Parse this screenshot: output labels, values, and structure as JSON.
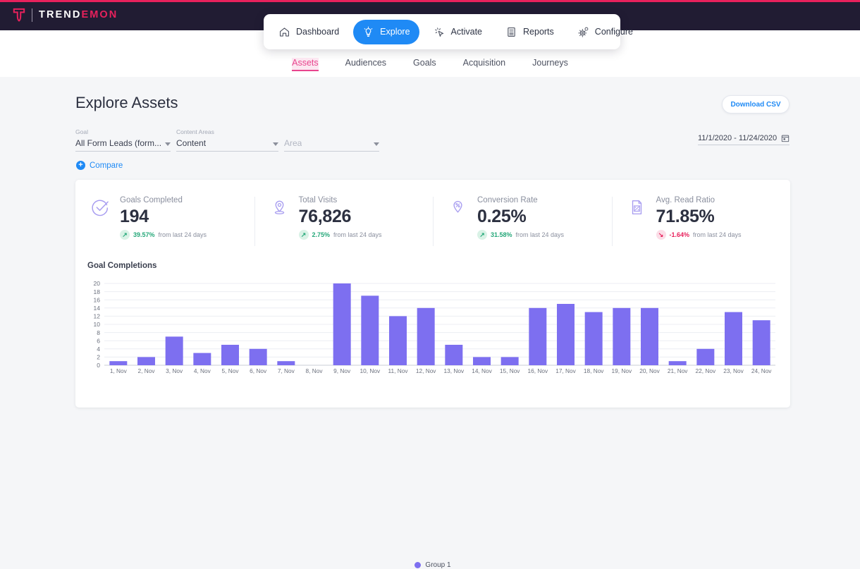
{
  "brand": {
    "name_part1": "TREND",
    "name_part2": "EMON"
  },
  "nav": {
    "items": [
      {
        "label": "Dashboard",
        "icon": "home-icon",
        "active": false
      },
      {
        "label": "Explore",
        "icon": "lightbulb-icon",
        "active": true
      },
      {
        "label": "Activate",
        "icon": "cursor-click-icon",
        "active": false
      },
      {
        "label": "Reports",
        "icon": "report-document-icon",
        "active": false
      },
      {
        "label": "Configure",
        "icon": "gear-icon",
        "active": false
      }
    ],
    "active_color": "#1f8af5"
  },
  "subtabs": {
    "items": [
      {
        "label": "Assets",
        "active": true
      },
      {
        "label": "Audiences",
        "active": false
      },
      {
        "label": "Goals",
        "active": false
      },
      {
        "label": "Acquisition",
        "active": false
      },
      {
        "label": "Journeys",
        "active": false
      }
    ],
    "active_color": "#e8458e"
  },
  "page": {
    "title": "Explore Assets",
    "download_label": "Download CSV"
  },
  "filters": {
    "goal": {
      "label": "Goal",
      "value": "All Form Leads (form..."
    },
    "content_areas": {
      "label": "Content Areas",
      "value": "Content"
    },
    "area": {
      "label": "",
      "placeholder": "Area"
    },
    "compare_label": "Compare",
    "date_range": "11/1/2020 - 11/24/2020"
  },
  "kpis": [
    {
      "icon": "check-circle-icon",
      "name": "Goals Completed",
      "value": "194",
      "delta": "39.57%",
      "delta_dir": "up",
      "delta_note": "from last 24 days"
    },
    {
      "icon": "location-pin-icon",
      "name": "Total Visits",
      "value": "76,826",
      "delta": "2.75%",
      "delta_dir": "up",
      "delta_note": "from last 24 days"
    },
    {
      "icon": "percent-shield-icon",
      "name": "Conversion Rate",
      "value": "0.25%",
      "delta": "31.58%",
      "delta_dir": "up",
      "delta_note": "from last 24 days"
    },
    {
      "icon": "percent-document-icon",
      "name": "Avg. Read Ratio",
      "value": "71.85%",
      "delta": "-1.64%",
      "delta_dir": "down",
      "delta_note": "from last 24 days"
    }
  ],
  "chart_data": {
    "type": "bar",
    "title": "Goal Completions",
    "xlabel": "",
    "ylabel": "",
    "ylim": [
      0,
      20
    ],
    "yticks": [
      0,
      2,
      4,
      6,
      8,
      10,
      12,
      14,
      16,
      18,
      20
    ],
    "grid": true,
    "legend_position": "bottom",
    "bar_color": "#7d6ff0",
    "categories": [
      "1, Nov",
      "2, Nov",
      "3, Nov",
      "4, Nov",
      "5, Nov",
      "6, Nov",
      "7, Nov",
      "8, Nov",
      "9, Nov",
      "10, Nov",
      "11, Nov",
      "12, Nov",
      "13, Nov",
      "14, Nov",
      "15, Nov",
      "16, Nov",
      "17, Nov",
      "18, Nov",
      "19, Nov",
      "20, Nov",
      "21, Nov",
      "22, Nov",
      "23, Nov",
      "24, Nov"
    ],
    "series": [
      {
        "name": "Group 1",
        "color": "#7d6ff0",
        "values": [
          1,
          2,
          7,
          3,
          5,
          4,
          1,
          0,
          20,
          17,
          12,
          14,
          5,
          2,
          2,
          14,
          15,
          13,
          14,
          14,
          1,
          4,
          13,
          11
        ]
      }
    ]
  }
}
